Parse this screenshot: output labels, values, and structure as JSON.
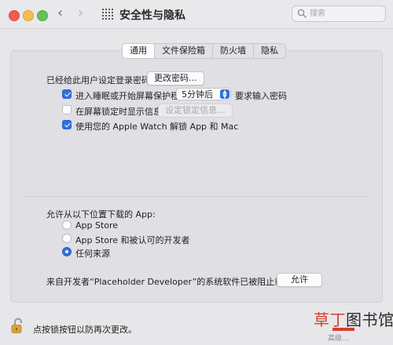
{
  "window": {
    "title": "安全性与隐私",
    "search_placeholder": "搜索"
  },
  "tabs": [
    {
      "label": "通用",
      "active": true
    },
    {
      "label": "文件保险箱",
      "active": false
    },
    {
      "label": "防火墙",
      "active": false
    },
    {
      "label": "隐私",
      "active": false
    }
  ],
  "general": {
    "password_set_label": "已经给此用户设定登录密码",
    "change_password_button": "更改密码...",
    "require_password": {
      "checked": true,
      "prefix_label": "进入睡眠或开始屏幕保护程序",
      "delay_value": "5分钟后",
      "suffix_label": "要求输入密码"
    },
    "lock_message": {
      "checked": false,
      "label": "在屏幕锁定时显示信息",
      "button": "设定锁定信息..."
    },
    "apple_watch": {
      "checked": true,
      "label": "使用您的 Apple Watch 解锁 App 和 Mac"
    }
  },
  "downloads": {
    "heading": "允许从以下位置下载的 App:",
    "options": [
      {
        "label": "App Store",
        "selected": false
      },
      {
        "label": "App Store 和被认可的开发者",
        "selected": false
      },
      {
        "label": "任何来源",
        "selected": true
      }
    ],
    "blocked_message": "来自开发者“Placeholder Developer”的系统软件已被阻止载入。",
    "allow_button": "允许"
  },
  "footer": {
    "lock_text": "点按锁按钮以防再次更改。"
  },
  "watermark": {
    "red_text": "草丁",
    "dark_text": "图书馆",
    "sub_text": "高级..."
  },
  "colors": {
    "accent": "#2f6fdd",
    "close": "#ee5e57",
    "minimize": "#f4be4f",
    "zoom": "#61c454",
    "lock": "#d9a33b"
  }
}
